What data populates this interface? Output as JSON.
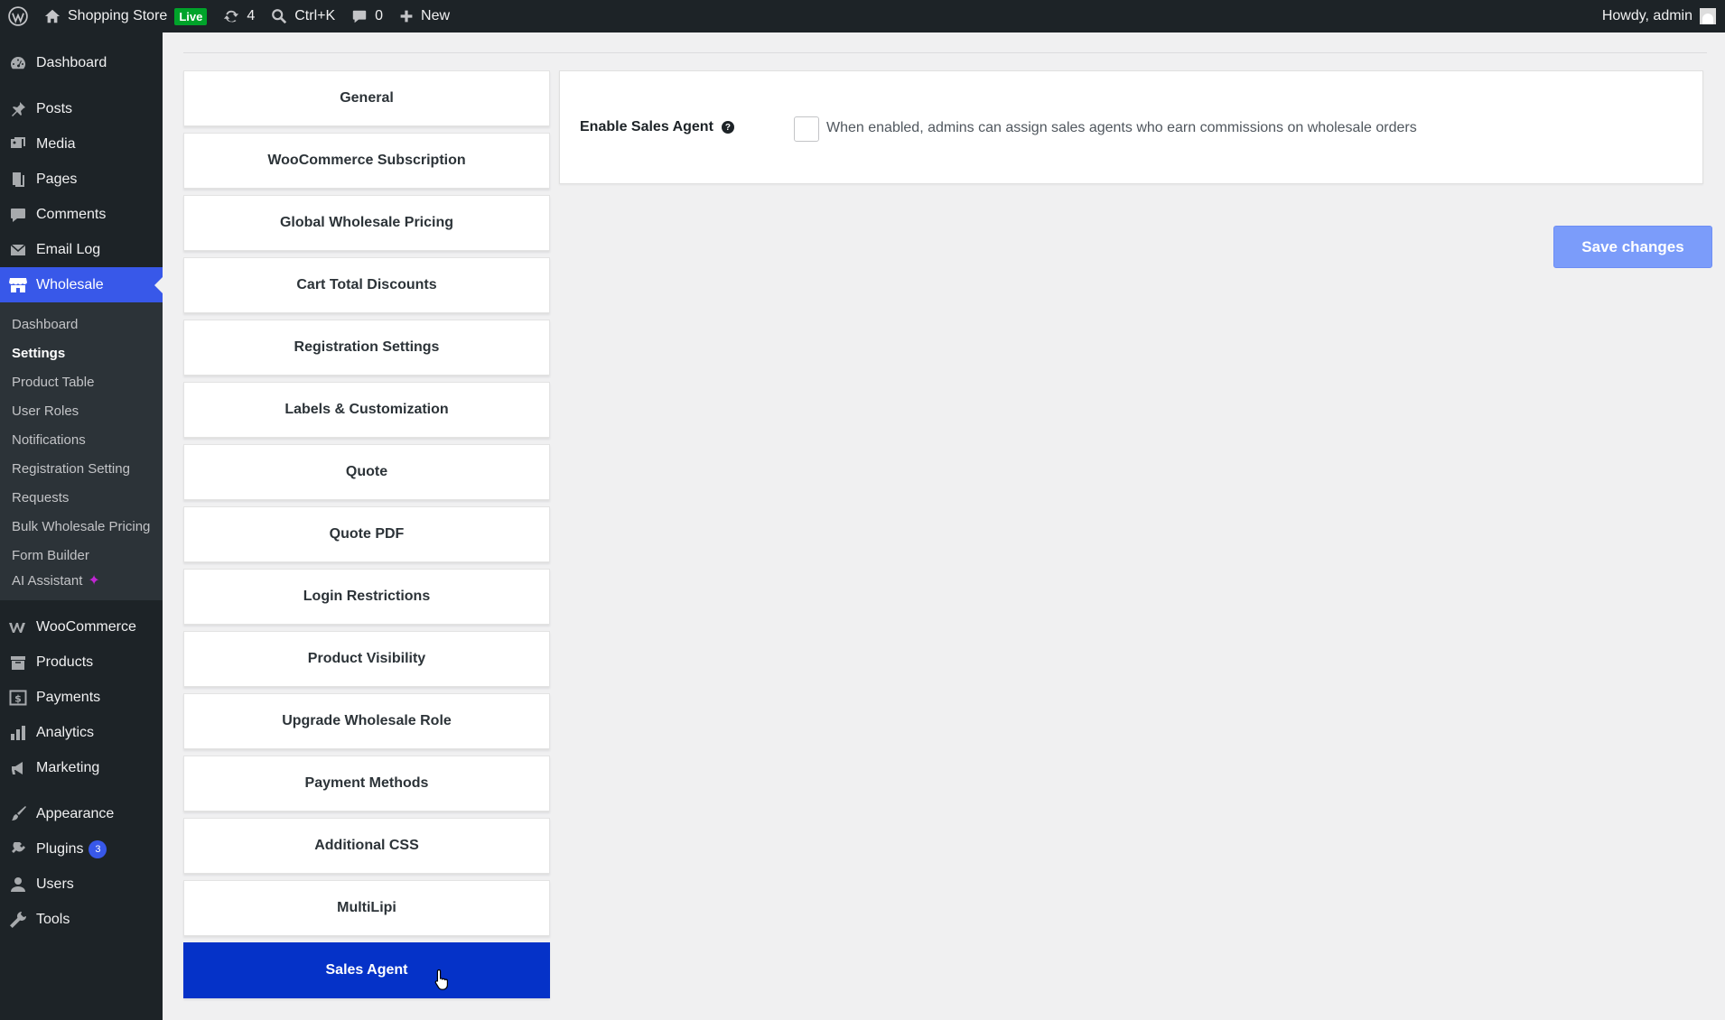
{
  "admin_bar": {
    "site_name": "Shopping Store",
    "live_badge": "Live",
    "updates_count": "4",
    "search_shortcut": "Ctrl+K",
    "comments_count": "0",
    "new_label": "New",
    "greeting": "Howdy, admin"
  },
  "sidebar": {
    "items": [
      {
        "label": "Dashboard",
        "icon": "dashboard-icon"
      },
      {
        "label": "Posts",
        "icon": "pin-icon"
      },
      {
        "label": "Media",
        "icon": "media-icon"
      },
      {
        "label": "Pages",
        "icon": "pages-icon"
      },
      {
        "label": "Comments",
        "icon": "comment-icon"
      },
      {
        "label": "Email Log",
        "icon": "email-icon"
      },
      {
        "label": "Wholesale",
        "icon": "store-icon"
      },
      {
        "label": "WooCommerce",
        "icon": "woocommerce-icon"
      },
      {
        "label": "Products",
        "icon": "archive-icon"
      },
      {
        "label": "Payments",
        "icon": "payments-icon"
      },
      {
        "label": "Analytics",
        "icon": "bar-chart-icon"
      },
      {
        "label": "Marketing",
        "icon": "megaphone-icon"
      },
      {
        "label": "Appearance",
        "icon": "brush-icon"
      },
      {
        "label": "Plugins",
        "icon": "plug-icon"
      },
      {
        "label": "Users",
        "icon": "user-icon"
      },
      {
        "label": "Tools",
        "icon": "wrench-icon"
      }
    ],
    "plugins_badge": "3",
    "submenu": [
      "Dashboard",
      "Settings",
      "Product Table",
      "User Roles",
      "Notifications",
      "Registration Setting",
      "Requests",
      "Bulk Wholesale Pricing",
      "Form Builder",
      "AI Assistant"
    ]
  },
  "tabs": [
    "General",
    "WooCommerce Subscription",
    "Global Wholesale Pricing",
    "Cart Total Discounts",
    "Registration Settings",
    "Labels & Customization",
    "Quote",
    "Quote PDF",
    "Login Restrictions",
    "Product Visibility",
    "Upgrade Wholesale Role",
    "Payment Methods",
    "Additional CSS",
    "MultiLipi",
    "Sales Agent"
  ],
  "settings": {
    "enable_label": "Enable Sales Agent",
    "help_glyph": "?",
    "enable_checked": false,
    "description": "When enabled, admins can assign sales agents who earn commissions on wholesale orders"
  },
  "save_button": "Save changes",
  "colors": {
    "accent": "#3858e9",
    "selected_tab": "#0532c8",
    "save_button": "#7b9cfa"
  }
}
